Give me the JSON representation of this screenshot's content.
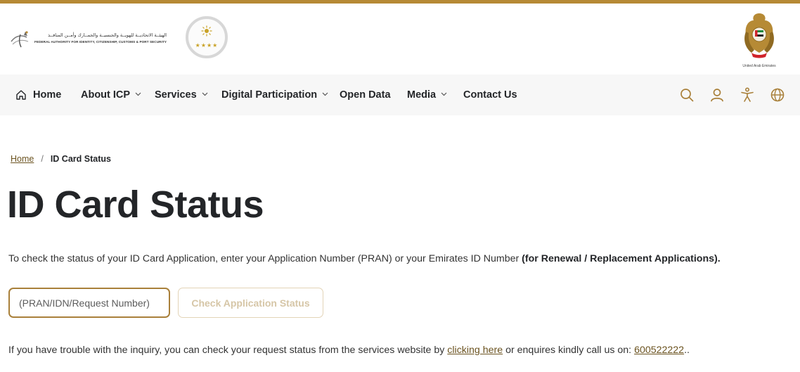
{
  "theme": {
    "accent": "#b68a35",
    "link": "#6b5320",
    "nav_bg": "#f7f7f7",
    "text": "#232528"
  },
  "header": {
    "icp_logo": {
      "name_ar": "الهيئــة الاتحاديــة للهويــة والجنسيــة والجمــارك وأمــن المنافــذ",
      "name_en": "FEDERAL AUTHORITY FOR IDENTITY, CITIZENSHIP, CUSTOMS & PORT SECURITY"
    },
    "rating_badge": {
      "stars": "★★★★",
      "icon": "star-rating-badge"
    },
    "uae_emblem": {
      "caption": "United Arab Emirates",
      "icon": "uae-emblem"
    }
  },
  "nav": {
    "items": [
      {
        "label": "Home",
        "icon": "home-icon",
        "dropdown": false
      },
      {
        "label": "About ICP",
        "dropdown": true
      },
      {
        "label": "Services",
        "dropdown": true
      },
      {
        "label": "Digital Participation",
        "dropdown": true
      },
      {
        "label": "Open Data",
        "dropdown": false
      },
      {
        "label": "Media",
        "dropdown": true
      },
      {
        "label": "Contact Us",
        "dropdown": false
      }
    ],
    "tools": [
      "search-icon",
      "user-icon",
      "accessibility-icon",
      "globe-icon"
    ]
  },
  "breadcrumb": {
    "home": "Home",
    "separator": "/",
    "current": "ID Card Status"
  },
  "page": {
    "title": "ID Card Status",
    "intro_text": "To check the status of your ID Card Application, enter your Application Number (PRAN) or your Emirates ID Number ",
    "intro_bold": "(for Renewal / Replacement Applications).",
    "input_placeholder": "(PRAN/IDN/Request Number)",
    "input_value": "",
    "check_button": "Check Application Status",
    "help_prefix": "If you have trouble with the inquiry, you can check your request status from the services website by ",
    "help_link": "clicking here",
    "help_middle": " or enquires kindly call us on: ",
    "help_phone": "600522222",
    "help_suffix": ".."
  }
}
